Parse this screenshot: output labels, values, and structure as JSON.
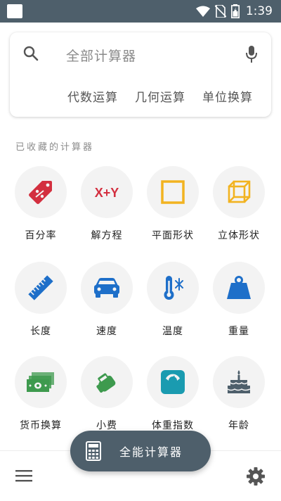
{
  "status_bar": {
    "time": "1:39"
  },
  "search": {
    "placeholder": "全部计算器",
    "chips": [
      "代数运算",
      "几何运算",
      "单位换算"
    ]
  },
  "section_title": "已收藏的计算器",
  "calculators": [
    {
      "label": "百分率",
      "icon": "percent-tag-icon"
    },
    {
      "label": "解方程",
      "icon": "equation-xy-icon",
      "text": "X+Y"
    },
    {
      "label": "平面形状",
      "icon": "square-shape-icon"
    },
    {
      "label": "立体形状",
      "icon": "cube-icon"
    },
    {
      "label": "长度",
      "icon": "ruler-icon"
    },
    {
      "label": "速度",
      "icon": "car-icon"
    },
    {
      "label": "温度",
      "icon": "thermometer-icon"
    },
    {
      "label": "重量",
      "icon": "weight-icon"
    },
    {
      "label": "货币换算",
      "icon": "banknote-icon"
    },
    {
      "label": "小费",
      "icon": "tip-hand-icon"
    },
    {
      "label": "体重指数",
      "icon": "scale-icon"
    },
    {
      "label": "年龄",
      "icon": "birthday-cake-icon"
    }
  ],
  "fab": {
    "label": "全能计算器",
    "icon": "calculator-icon"
  },
  "colors": {
    "status_bar": "#4e5f6b",
    "red": "#d32f3f",
    "yellow": "#f2b320",
    "blue": "#1e6fc9",
    "green": "#3e9a4e",
    "teal": "#1a9bb0",
    "dark": "#4e5f6b"
  }
}
